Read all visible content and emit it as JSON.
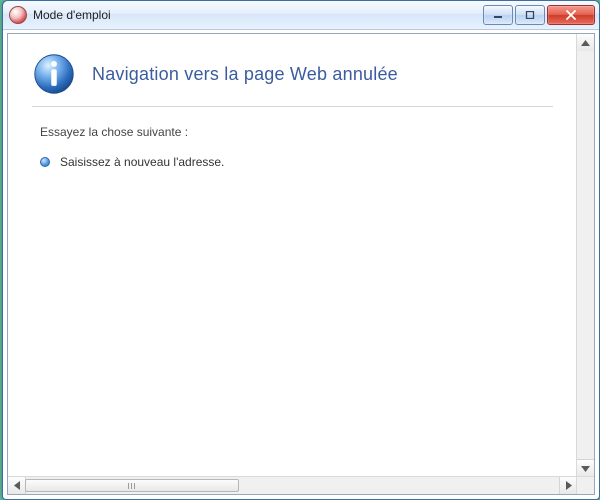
{
  "window": {
    "title": "Mode d'emploi"
  },
  "page": {
    "heading": "Navigation vers la page Web annulée",
    "intro": "Essayez la chose suivante :",
    "suggestions": [
      "Saisissez à nouveau l'adresse."
    ]
  }
}
